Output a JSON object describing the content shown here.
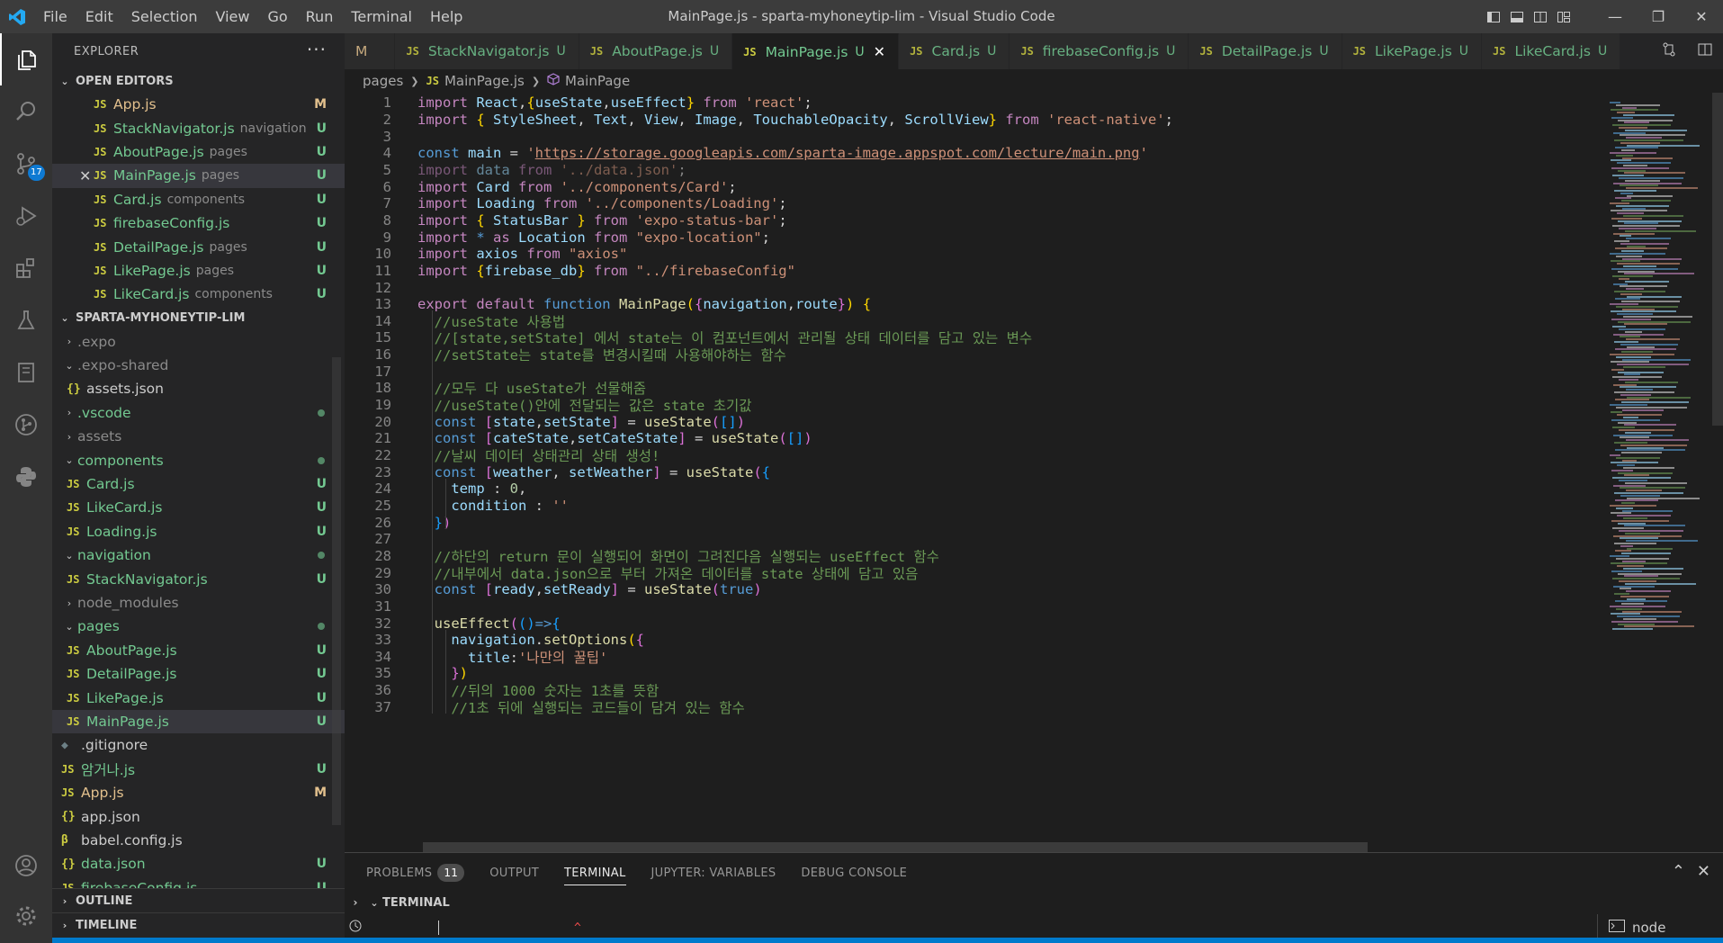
{
  "titlebar": {
    "menu": [
      "File",
      "Edit",
      "Selection",
      "View",
      "Go",
      "Run",
      "Terminal",
      "Help"
    ],
    "window_title": "MainPage.js - sparta-myhoneytip-lim - Visual Studio Code",
    "icons": [
      "toggle-sidebar-icon",
      "toggle-panel-icon",
      "toggle-secondary-sidebar-icon",
      "customize-layout-icon"
    ],
    "controls": {
      "minimize": "—",
      "restore": "❐",
      "close": "✕"
    }
  },
  "activitybar": {
    "items": [
      "explorer-icon",
      "search-icon",
      "source-control-icon",
      "run-debug-icon",
      "extensions-icon",
      "testing-icon",
      "notebook-icon",
      "git-graph-icon",
      "python-icon"
    ],
    "scm_badge": "17",
    "bottom": [
      "accounts-icon",
      "manage-gear-icon"
    ]
  },
  "sidebar": {
    "title": "EXPLORER",
    "more": "···",
    "open_editors_title": "OPEN EDITORS",
    "open_editors": [
      {
        "name": "App.js",
        "desc": "",
        "status": "M"
      },
      {
        "name": "StackNavigator.js",
        "desc": "navigation",
        "status": "U"
      },
      {
        "name": "AboutPage.js",
        "desc": "pages",
        "status": "U"
      },
      {
        "name": "MainPage.js",
        "desc": "pages",
        "status": "U"
      },
      {
        "name": "Card.js",
        "desc": "components",
        "status": "U"
      },
      {
        "name": "firebaseConfig.js",
        "desc": "",
        "status": "U"
      },
      {
        "name": "DetailPage.js",
        "desc": "pages",
        "status": "U"
      },
      {
        "name": "LikePage.js",
        "desc": "pages",
        "status": "U"
      },
      {
        "name": "LikeCard.js",
        "desc": "components",
        "status": "U"
      }
    ],
    "project_title": "SPARTA-MYHONEYTIP-LIM",
    "tree": [
      {
        "name": ".expo",
        "type": "folder-closed",
        "depth": 0
      },
      {
        "name": ".expo-shared",
        "type": "folder-open",
        "depth": 0
      },
      {
        "name": "assets.json",
        "type": "json",
        "depth": 1
      },
      {
        "name": ".vscode",
        "type": "folder-closed",
        "depth": 0,
        "dot": true
      },
      {
        "name": "assets",
        "type": "folder-closed",
        "depth": 0
      },
      {
        "name": "components",
        "type": "folder-open",
        "depth": 0,
        "dot": true
      },
      {
        "name": "Card.js",
        "type": "js",
        "depth": 1,
        "status": "U"
      },
      {
        "name": "LikeCard.js",
        "type": "js",
        "depth": 1,
        "status": "U"
      },
      {
        "name": "Loading.js",
        "type": "js",
        "depth": 1,
        "status": "U"
      },
      {
        "name": "navigation",
        "type": "folder-open",
        "depth": 0,
        "dot": true
      },
      {
        "name": "StackNavigator.js",
        "type": "js",
        "depth": 1,
        "status": "U"
      },
      {
        "name": "node_modules",
        "type": "folder-closed",
        "depth": 0
      },
      {
        "name": "pages",
        "type": "folder-open",
        "depth": 0,
        "dot": true
      },
      {
        "name": "AboutPage.js",
        "type": "js",
        "depth": 1,
        "status": "U"
      },
      {
        "name": "DetailPage.js",
        "type": "js",
        "depth": 1,
        "status": "U"
      },
      {
        "name": "LikePage.js",
        "type": "js",
        "depth": 1,
        "status": "U"
      },
      {
        "name": "MainPage.js",
        "type": "js",
        "depth": 1,
        "status": "U"
      },
      {
        "name": ".gitignore",
        "type": "gitignore",
        "depth": 0
      },
      {
        "name": "암거나.js",
        "type": "js",
        "depth": 0,
        "status": "U"
      },
      {
        "name": "App.js",
        "type": "js",
        "depth": 0,
        "status": "M"
      },
      {
        "name": "app.json",
        "type": "json",
        "depth": 0
      },
      {
        "name": "babel.config.js",
        "type": "babel",
        "depth": 0
      },
      {
        "name": "data.json",
        "type": "json",
        "depth": 0,
        "status": "U"
      },
      {
        "name": "firebaseConfig.js",
        "type": "js",
        "depth": 0,
        "status": "U"
      }
    ],
    "outline_title": "OUTLINE",
    "timeline_title": "TIMELINE"
  },
  "tabs": [
    {
      "name": "M",
      "js": false,
      "u": "",
      "active": false
    },
    {
      "name": "StackNavigator.js",
      "js": true,
      "u": "U",
      "active": false
    },
    {
      "name": "AboutPage.js",
      "js": true,
      "u": "U",
      "active": false
    },
    {
      "name": "MainPage.js",
      "js": true,
      "u": "U",
      "active": true
    },
    {
      "name": "Card.js",
      "js": true,
      "u": "U",
      "active": false
    },
    {
      "name": "firebaseConfig.js",
      "js": true,
      "u": "U",
      "active": false
    },
    {
      "name": "DetailPage.js",
      "js": true,
      "u": "U",
      "active": false
    },
    {
      "name": "LikePage.js",
      "js": true,
      "u": "U",
      "active": false
    },
    {
      "name": "LikeCard.js",
      "js": true,
      "u": "U",
      "active": false
    }
  ],
  "breadcrumb": {
    "folder": "pages",
    "file": "MainPage.js",
    "symbol": "MainPage"
  },
  "editor": {
    "lines": [
      {
        "n": "1",
        "t": [
          [
            "import ",
            "k"
          ],
          [
            "React",
            "v"
          ],
          [
            ",",
            ""
          ],
          [
            "{",
            "p1"
          ],
          [
            "useState",
            "v"
          ],
          [
            ",",
            ""
          ],
          [
            "useEffect",
            "v"
          ],
          [
            "}",
            "p1"
          ],
          [
            " from ",
            "k"
          ],
          [
            "'react'",
            "s"
          ],
          [
            ";",
            ""
          ]
        ]
      },
      {
        "n": "2",
        "t": [
          [
            "import ",
            "k"
          ],
          [
            "{ ",
            "p1"
          ],
          [
            "StyleSheet",
            "v"
          ],
          [
            ", ",
            ""
          ],
          [
            "Text",
            "v"
          ],
          [
            ", ",
            ""
          ],
          [
            "View",
            "v"
          ],
          [
            ", ",
            ""
          ],
          [
            "Image",
            "v"
          ],
          [
            ", ",
            ""
          ],
          [
            "TouchableOpacity",
            "v"
          ],
          [
            ", ",
            ""
          ],
          [
            "ScrollView",
            "v"
          ],
          [
            "}",
            "p1"
          ],
          [
            " from ",
            "k"
          ],
          [
            "'react-native'",
            "s"
          ],
          [
            ";",
            ""
          ]
        ]
      },
      {
        "n": "3",
        "t": []
      },
      {
        "n": "4",
        "t": [
          [
            "const ",
            "b"
          ],
          [
            "main",
            "v"
          ],
          [
            " = ",
            ""
          ],
          [
            "'",
            "s"
          ],
          [
            "https://storage.googleapis.com/sparta-image.appspot.com/lecture/main.png",
            "s url"
          ],
          [
            "'",
            "s"
          ]
        ]
      },
      {
        "n": "5",
        "t": [
          [
            "import ",
            "k dim"
          ],
          [
            "data",
            "v dim"
          ],
          [
            " from ",
            "k dim"
          ],
          [
            "'../data.json'",
            "s dim"
          ],
          [
            ";",
            "dim"
          ]
        ]
      },
      {
        "n": "6",
        "t": [
          [
            "import ",
            "k"
          ],
          [
            "Card",
            "v"
          ],
          [
            " from ",
            "k"
          ],
          [
            "'../components/Card'",
            "s"
          ],
          [
            ";",
            ""
          ]
        ]
      },
      {
        "n": "7",
        "t": [
          [
            "import ",
            "k"
          ],
          [
            "Loading",
            "v"
          ],
          [
            " from ",
            "k"
          ],
          [
            "'../components/Loading'",
            "s"
          ],
          [
            ";",
            ""
          ]
        ]
      },
      {
        "n": "8",
        "t": [
          [
            "import ",
            "k"
          ],
          [
            "{ ",
            "p1"
          ],
          [
            "StatusBar",
            "v"
          ],
          [
            " }",
            "p1"
          ],
          [
            " from ",
            "k"
          ],
          [
            "'expo-status-bar'",
            "s"
          ],
          [
            ";",
            ""
          ]
        ]
      },
      {
        "n": "9",
        "t": [
          [
            "import ",
            "k"
          ],
          [
            "* ",
            "b"
          ],
          [
            "as ",
            "k"
          ],
          [
            "Location",
            "v"
          ],
          [
            " from ",
            "k"
          ],
          [
            "\"expo-location\"",
            "s"
          ],
          [
            ";",
            ""
          ]
        ]
      },
      {
        "n": "10",
        "t": [
          [
            "import ",
            "k"
          ],
          [
            "axios",
            "v"
          ],
          [
            " from ",
            "k"
          ],
          [
            "\"axios\"",
            "s"
          ]
        ]
      },
      {
        "n": "11",
        "t": [
          [
            "import ",
            "k"
          ],
          [
            "{",
            "p1"
          ],
          [
            "firebase_db",
            "v"
          ],
          [
            "}",
            "p1"
          ],
          [
            " from ",
            "k"
          ],
          [
            "\"../firebaseConfig\"",
            "s"
          ]
        ]
      },
      {
        "n": "12",
        "t": []
      },
      {
        "n": "13",
        "t": [
          [
            "export ",
            "k"
          ],
          [
            "default ",
            "k"
          ],
          [
            "function ",
            "b"
          ],
          [
            "MainPage",
            "f"
          ],
          [
            "(",
            "p1"
          ],
          [
            "{",
            "p2"
          ],
          [
            "navigation",
            "v"
          ],
          [
            ",",
            ""
          ],
          [
            "route",
            "v"
          ],
          [
            "}",
            "p2"
          ],
          [
            ")",
            "p1"
          ],
          [
            " {",
            "p1"
          ]
        ]
      },
      {
        "n": "14",
        "t": [
          [
            "  //useState 사용법",
            "c"
          ]
        ]
      },
      {
        "n": "15",
        "t": [
          [
            "  //[state,setState] 에서 state는 이 컴포넌트에서 관리될 상태 데이터를 담고 있는 변수",
            "c"
          ]
        ]
      },
      {
        "n": "16",
        "t": [
          [
            "  //setState는 state를 변경시킬때 사용해야하는 함수",
            "c"
          ]
        ]
      },
      {
        "n": "17",
        "t": []
      },
      {
        "n": "18",
        "t": [
          [
            "  //모두 다 useState가 선물해줌",
            "c"
          ]
        ]
      },
      {
        "n": "19",
        "t": [
          [
            "  //useState()안에 전달되는 값은 state 초기값",
            "c"
          ]
        ]
      },
      {
        "n": "20",
        "t": [
          [
            "  const ",
            "b"
          ],
          [
            "[",
            "p2"
          ],
          [
            "state",
            "v"
          ],
          [
            ",",
            ""
          ],
          [
            "setState",
            "v"
          ],
          [
            "]",
            "p2"
          ],
          [
            " = ",
            ""
          ],
          [
            "useState",
            "f"
          ],
          [
            "(",
            "p2"
          ],
          [
            "[]",
            "p3"
          ],
          [
            ")",
            "p2"
          ]
        ]
      },
      {
        "n": "21",
        "t": [
          [
            "  const ",
            "b"
          ],
          [
            "[",
            "p2"
          ],
          [
            "cateState",
            "v"
          ],
          [
            ",",
            ""
          ],
          [
            "setCateState",
            "v"
          ],
          [
            "]",
            "p2"
          ],
          [
            " = ",
            ""
          ],
          [
            "useState",
            "f"
          ],
          [
            "(",
            "p2"
          ],
          [
            "[]",
            "p3"
          ],
          [
            ")",
            "p2"
          ]
        ]
      },
      {
        "n": "22",
        "t": [
          [
            "  //날씨 데이터 상태관리 상태 생성!",
            "c"
          ]
        ]
      },
      {
        "n": "23",
        "t": [
          [
            "  const ",
            "b"
          ],
          [
            "[",
            "p2"
          ],
          [
            "weather",
            "v"
          ],
          [
            ", ",
            ""
          ],
          [
            "setWeather",
            "v"
          ],
          [
            "]",
            "p2"
          ],
          [
            " = ",
            ""
          ],
          [
            "useState",
            "f"
          ],
          [
            "(",
            "p2"
          ],
          [
            "{",
            "p3"
          ]
        ]
      },
      {
        "n": "24",
        "t": [
          [
            "    temp",
            "v"
          ],
          [
            " : ",
            ""
          ],
          [
            "0",
            "n"
          ],
          [
            ",",
            ""
          ]
        ]
      },
      {
        "n": "25",
        "t": [
          [
            "    condition",
            "v"
          ],
          [
            " : ",
            ""
          ],
          [
            "''",
            "s"
          ]
        ]
      },
      {
        "n": "26",
        "t": [
          [
            "  ",
            ""
          ],
          [
            "}",
            "p3"
          ],
          [
            ")",
            "p2"
          ]
        ]
      },
      {
        "n": "27",
        "t": []
      },
      {
        "n": "28",
        "t": [
          [
            "  //하단의 return 문이 실행되어 화면이 그려진다음 실행되는 useEffect 함수",
            "c"
          ]
        ]
      },
      {
        "n": "29",
        "t": [
          [
            "  //내부에서 data.json으로 부터 가져온 데이터를 state 상태에 담고 있음",
            "c"
          ]
        ]
      },
      {
        "n": "30",
        "t": [
          [
            "  const ",
            "b"
          ],
          [
            "[",
            "p2"
          ],
          [
            "ready",
            "v"
          ],
          [
            ",",
            ""
          ],
          [
            "setReady",
            "v"
          ],
          [
            "]",
            "p2"
          ],
          [
            " = ",
            ""
          ],
          [
            "useState",
            "f"
          ],
          [
            "(",
            "p2"
          ],
          [
            "true",
            "b"
          ],
          [
            ")",
            "p2"
          ]
        ]
      },
      {
        "n": "31",
        "t": []
      },
      {
        "n": "32",
        "t": [
          [
            "  useEffect",
            "f"
          ],
          [
            "(",
            "p2"
          ],
          [
            "()",
            "p3"
          ],
          [
            "=>",
            "b"
          ],
          [
            "{",
            "p3"
          ]
        ]
      },
      {
        "n": "33",
        "t": [
          [
            "    navigation",
            "v"
          ],
          [
            ".",
            ""
          ],
          [
            "setOptions",
            "f"
          ],
          [
            "(",
            "p1"
          ],
          [
            "{",
            "p2"
          ]
        ]
      },
      {
        "n": "34",
        "t": [
          [
            "      title",
            "v"
          ],
          [
            ":",
            ""
          ],
          [
            "'나만의 꿀팁'",
            "s"
          ]
        ]
      },
      {
        "n": "35",
        "t": [
          [
            "    ",
            ""
          ],
          [
            "}",
            "p2"
          ],
          [
            ")",
            "p1"
          ]
        ]
      },
      {
        "n": "36",
        "t": [
          [
            "    //뒤의 1000 숫자는 1초를 뜻함",
            "c"
          ]
        ]
      },
      {
        "n": "37",
        "t": [
          [
            "    //1초 뒤에 실행되는 코드들이 담겨 있는 함수",
            "c"
          ]
        ]
      }
    ]
  },
  "panel": {
    "tabs": [
      "PROBLEMS",
      "OUTPUT",
      "TERMINAL",
      "JUPYTER: VARIABLES",
      "DEBUG CONSOLE"
    ],
    "active_tab": "TERMINAL",
    "problems_count": "11",
    "terminal_title": "TERMINAL",
    "terminal_instance": "node",
    "maximize": "⌃",
    "close": "✕"
  },
  "colors": {
    "accent": "#007acc",
    "untracked": "#73c991",
    "modified": "#e2c08d",
    "js_icon": "#cbcb41"
  }
}
